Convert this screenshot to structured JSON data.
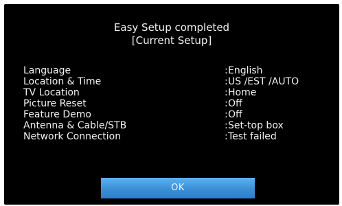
{
  "dialog": {
    "title": "Easy Setup completed",
    "subtitle": "[Current Setup]",
    "separator": ":",
    "settings": [
      {
        "label": "Language",
        "value": "English"
      },
      {
        "label": "Location & Time",
        "value": "US /EST /AUTO"
      },
      {
        "label": "TV Location",
        "value": "Home"
      },
      {
        "label": "Picture Reset",
        "value": "Off"
      },
      {
        "label": "Feature Demo",
        "value": "Off"
      },
      {
        "label": "Antenna & Cable/STB",
        "value": "Set-top box"
      },
      {
        "label": "Network Connection",
        "value": "Test failed"
      }
    ],
    "ok_label": "OK",
    "accent_color": "#3a8fd6"
  }
}
